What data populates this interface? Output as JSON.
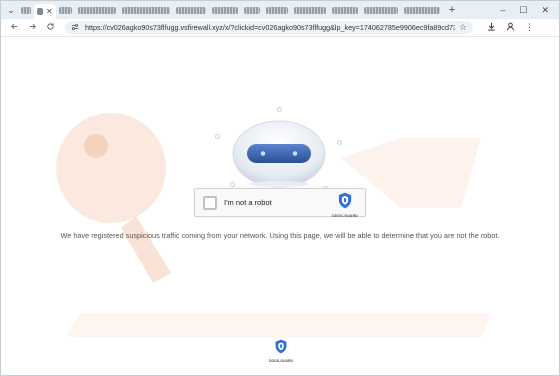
{
  "browser": {
    "url": "https://cv026agko90s73flfugg.vsfirewall.xyz/x/?clickid=cv026agko90s73flfugg&lp_key=174062785e9906ec9fa89cd73...",
    "tabs_visible_count": 13,
    "new_tab_symbol": "+",
    "window_controls": [
      "–",
      "☐",
      "✕"
    ]
  },
  "icons": {
    "back": "back-arrow-icon",
    "forward": "forward-arrow-icon",
    "reload": "reload-icon",
    "site_settings": "site-settings-icon",
    "bookmark": "star-icon",
    "download": "download-icon",
    "profile": "profile-icon",
    "menu": "kebab-menu-icon"
  },
  "captcha": {
    "label": "I'm not a robot",
    "brand": "DDOS-GUARD",
    "checked": false
  },
  "message": "We have registered suspicious traffic coming from your network. Using this page, we will be able to determine that you are not the robot.",
  "footer": {
    "brand": "DDOS-GUARD"
  },
  "colors": {
    "shield_blue": "#2f6fd6",
    "robot_visor": "#3b66b8",
    "watermark": "#f6d9c6"
  }
}
